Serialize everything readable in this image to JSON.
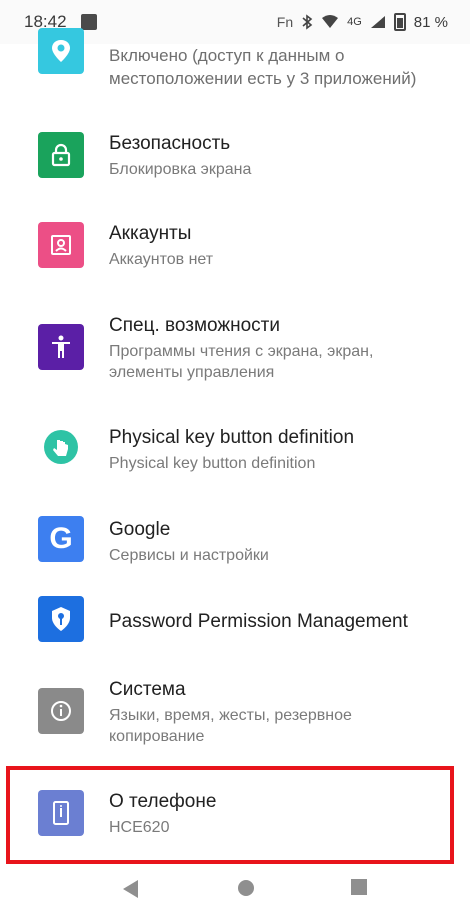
{
  "status": {
    "time": "18:42",
    "carrier": "Fn",
    "network": "4G",
    "battery": "81 %"
  },
  "items": [
    {
      "title": "",
      "summary": "Включено (доступ к данным о местоположении есть у 3 приложений)",
      "icon": "location-icon",
      "color": "#35c8e0"
    },
    {
      "title": "Безопасность",
      "summary": "Блокировка экрана",
      "icon": "lock-icon",
      "color": "#1aa35c"
    },
    {
      "title": "Аккаунты",
      "summary": "Аккаунтов нет",
      "icon": "account-icon",
      "color": "#ec4f86"
    },
    {
      "title": "Спец. возможности",
      "summary": "Программы чтения с экрана, экран, элементы управления",
      "icon": "accessibility-icon",
      "color": "#5b1fa6"
    },
    {
      "title": "Physical key button definition",
      "summary": "Physical key button definition",
      "icon": "touch-hand-icon",
      "color": "#2ec3a5"
    },
    {
      "title": "Google",
      "summary": "Сервисы и настройки",
      "icon": "google-icon",
      "color": "#3d7ff0"
    },
    {
      "title": "Password Permission Management",
      "summary": "",
      "icon": "shield-key-icon",
      "color": "#1d6fe0"
    },
    {
      "title": "Система",
      "summary": "Языки, время, жесты, резервное копирование",
      "icon": "info-icon",
      "color": "#8a8a8a"
    },
    {
      "title": "О телефоне",
      "summary": "HCE620",
      "icon": "phone-icon",
      "color": "#6b7fd2"
    }
  ],
  "navigation": {
    "back": "back-icon",
    "home": "home-icon",
    "recents": "recents-icon"
  }
}
